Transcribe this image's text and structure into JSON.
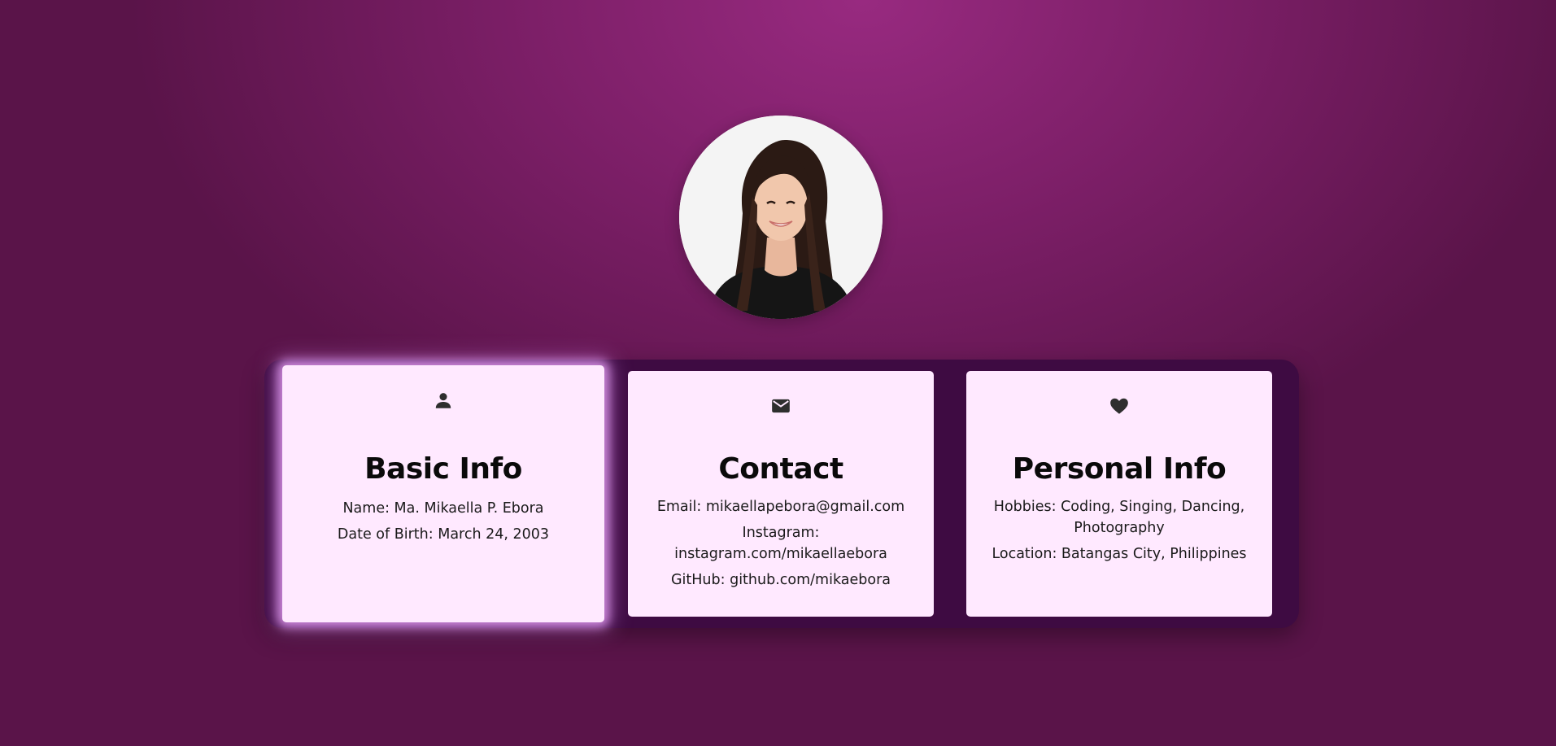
{
  "profile": {
    "avatar_alt": "Profile photo"
  },
  "cards": [
    {
      "icon": "person-icon",
      "title": "Basic Info",
      "lines": [
        "Name: Ma. Mikaella P. Ebora",
        "Date of Birth: March 24, 2003"
      ]
    },
    {
      "icon": "envelope-icon",
      "title": "Contact",
      "lines": [
        "Email: mikaellapebora@gmail.com",
        "Instagram: instagram.com/mikaellaebora",
        "GitHub: github.com/mikaebora"
      ]
    },
    {
      "icon": "heart-icon",
      "title": "Personal Info",
      "lines": [
        "Hobbies: Coding, Singing, Dancing, Photography",
        "Location: Batangas City, Philippines"
      ]
    }
  ],
  "colors": {
    "background": "#7d1f68",
    "panel": "#3e0b42",
    "card": "#ffe9ff",
    "active_glow": "#dc96eb"
  }
}
